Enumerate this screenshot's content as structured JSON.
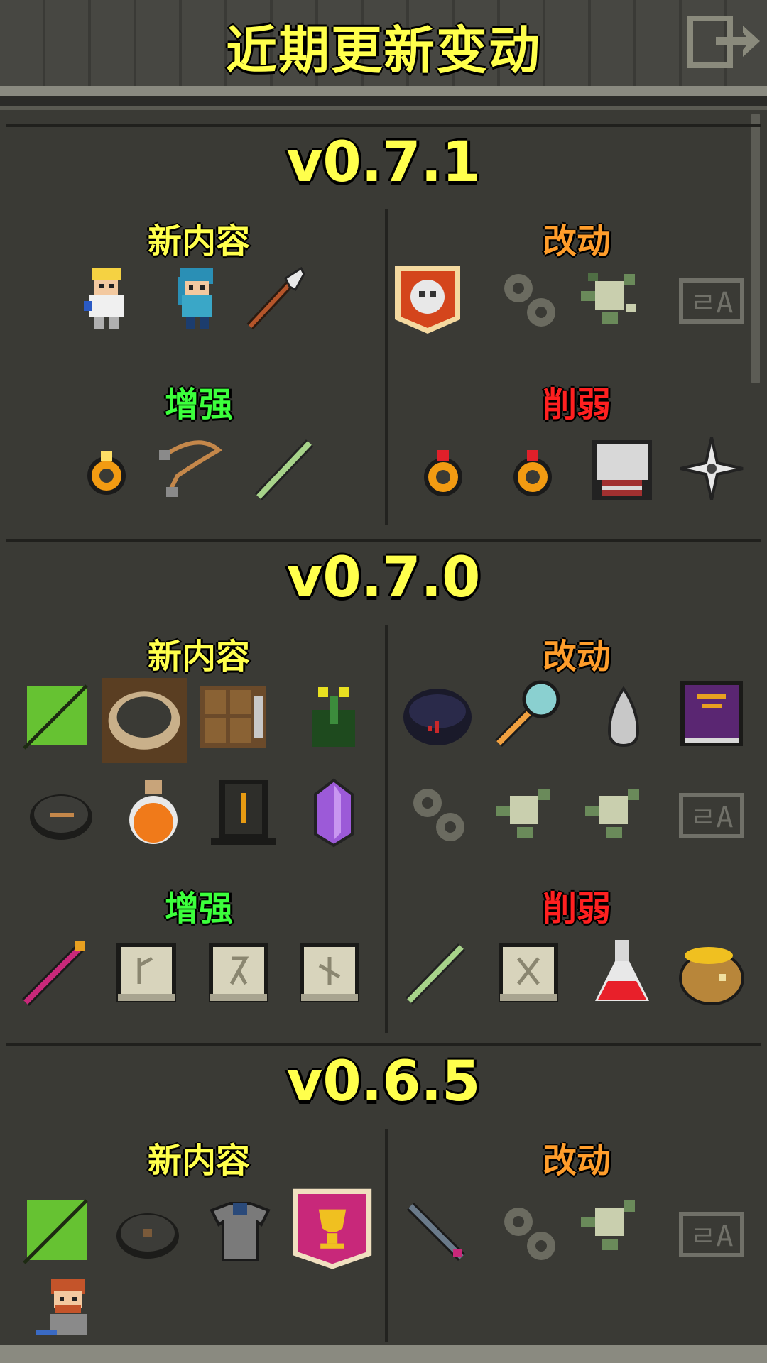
{
  "header": {
    "title": "近期更新变动",
    "exit_icon": "exit-icon"
  },
  "labels": {
    "new_content": "新内容",
    "changes": "改动",
    "buffs": "增强",
    "nerfs": "削弱"
  },
  "colors": {
    "title": "#ffff4c",
    "new": "#ffff4c",
    "changes": "#ff9d2b",
    "buffs": "#3cff3c",
    "nerfs": "#ff2020"
  },
  "versions": [
    {
      "version": "v0.7.1"
    },
    {
      "version": "v0.7.0"
    },
    {
      "version": "v0.6.5"
    }
  ]
}
